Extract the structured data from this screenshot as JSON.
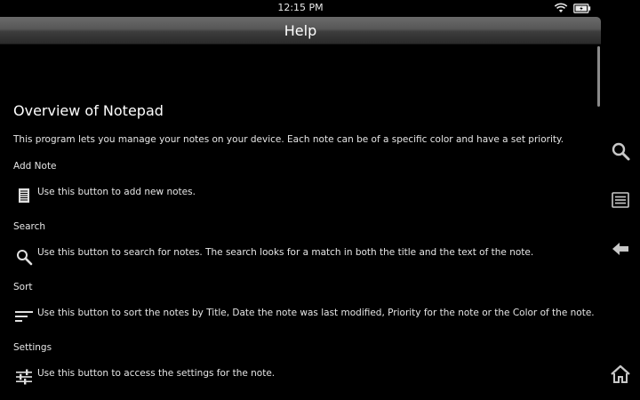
{
  "status_bar": {
    "time": "12:15 PM"
  },
  "title_bar": {
    "title": "Help"
  },
  "content": {
    "heading": "Overview of Notepad",
    "intro": "This program lets you manage your notes on your device. Each note can be of a specific color and have a set priority.",
    "sections": [
      {
        "title": "Add Note",
        "icon": "add-note-icon",
        "description": "Use this button to add new notes."
      },
      {
        "title": "Search",
        "icon": "search-icon",
        "description": "Use this button to search for notes. The search looks for a match in both the title and the text of the note."
      },
      {
        "title": "Sort",
        "icon": "sort-icon",
        "description": "Use this button to sort the notes by Title, Date the note was last modified, Priority for the note or the Color of the note."
      },
      {
        "title": "Settings",
        "icon": "settings-sliders-icon",
        "description": "Use this button to access the settings for the note."
      }
    ]
  },
  "side_nav": {
    "items": [
      "search-icon",
      "menu-icon",
      "back-arrow-icon",
      "home-icon"
    ]
  },
  "colors": {
    "background": "#000000",
    "title_bar": "#4a4a4a",
    "text": "#e6e6e6"
  }
}
